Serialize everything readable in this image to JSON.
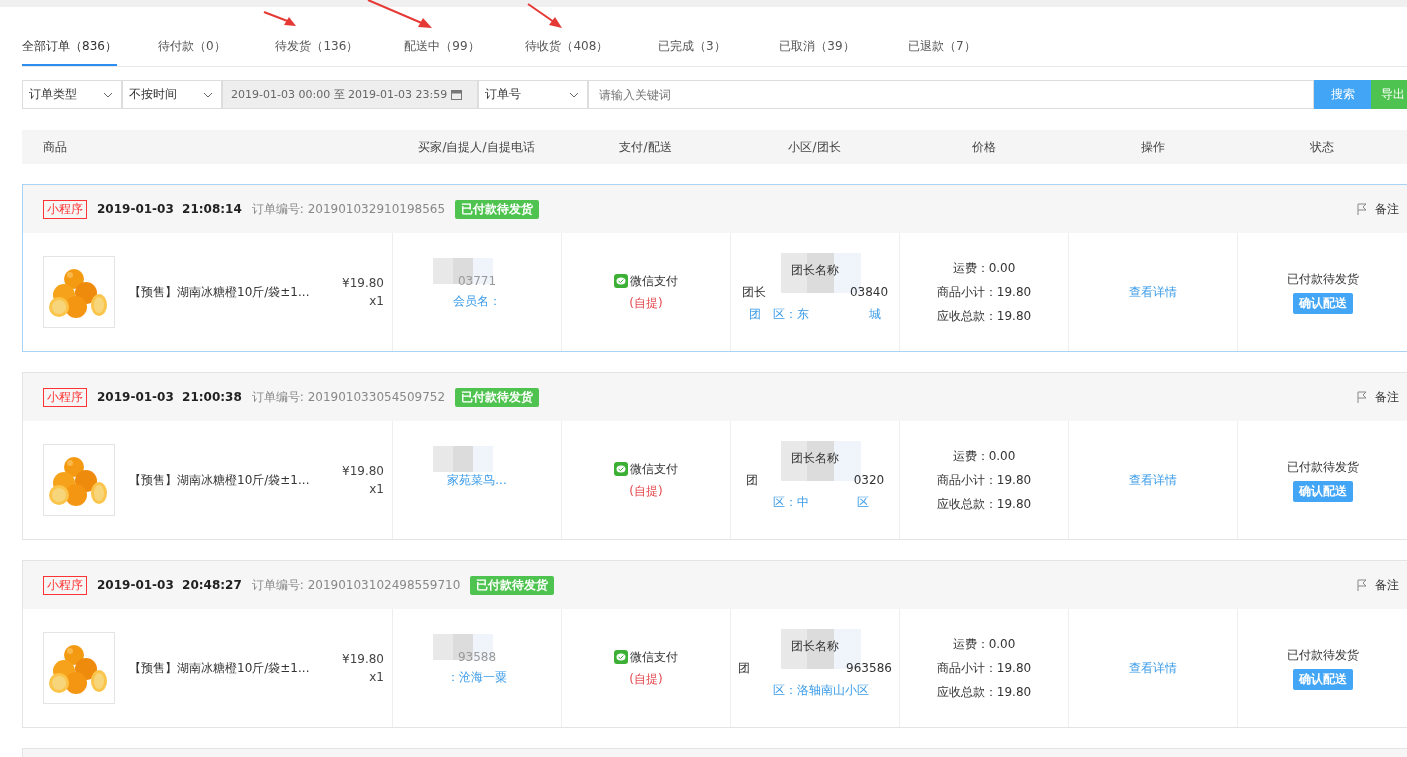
{
  "tabs": [
    {
      "label": "全部订单（836）",
      "selected": true
    },
    {
      "label": "待付款（0）",
      "selected": false
    },
    {
      "label": "待发货（136）",
      "selected": false
    },
    {
      "label": "配送中（99）",
      "selected": false
    },
    {
      "label": "待收货（408）",
      "selected": false
    },
    {
      "label": "已完成（3）",
      "selected": false
    },
    {
      "label": "已取消（39）",
      "selected": false
    },
    {
      "label": "已退款（7）",
      "selected": false
    }
  ],
  "filters": {
    "order_type": "订单类型",
    "time_mode": "不按时间",
    "date_range": "2019-01-03 00:00 至 2019-01-03 23:59",
    "field": "订单号",
    "placeholder": "请输入关键词",
    "search_button": "搜索",
    "export_button": "导出"
  },
  "columns": [
    "商品",
    "买家/自提人/自提电话",
    "支付/配送",
    "小区/团长",
    "价格",
    "操作",
    "状态"
  ],
  "orders": [
    {
      "source": "小程序",
      "datetime": "2019-01-03  21:08:14",
      "order_no": "订单编号: 201901032910198565",
      "badge": "已付款待发货",
      "remark": "备注",
      "product": {
        "name": "【预售】湖南冰糖橙10斤/袋±1...",
        "price": "¥19.80",
        "qty": "x1"
      },
      "buyer": [
        {
          "text": "03771",
          "kind": "plain"
        },
        {
          "text": "会员名：",
          "kind": "link"
        }
      ],
      "payment": "微信支付",
      "delivery": "(自提)",
      "leader": [
        {
          "text": "团长名称",
          "kind": "plain"
        },
        {
          "text": "团长　　　　　　　03840",
          "kind": "plain"
        },
        {
          "text": "团　区：东　　　　　城",
          "kind": "link"
        }
      ],
      "fees": [
        "运费：0.00",
        "商品小计：19.80",
        "应收总款：19.80"
      ],
      "action": "查看详情",
      "status": "已付款待发货",
      "confirm": "确认配送",
      "highlighted": true
    },
    {
      "source": "小程序",
      "datetime": "2019-01-03  21:00:38",
      "order_no": "订单编号: 201901033054509752",
      "badge": "已付款待发货",
      "remark": "备注",
      "product": {
        "name": "【预售】湖南冰糖橙10斤/袋±1...",
        "price": "¥19.80",
        "qty": "x1"
      },
      "buyer": [
        {
          "text": "家苑菜鸟...",
          "kind": "link"
        }
      ],
      "payment": "微信支付",
      "delivery": "(自提)",
      "leader": [
        {
          "text": "团长名称",
          "kind": "plain"
        },
        {
          "text": "团　　　　　　　　0320",
          "kind": "plain"
        },
        {
          "text": "　区：中　　　　区",
          "kind": "link"
        }
      ],
      "fees": [
        "运费：0.00",
        "商品小计：19.80",
        "应收总款：19.80"
      ],
      "action": "查看详情",
      "status": "已付款待发货",
      "confirm": "确认配送",
      "highlighted": false
    },
    {
      "source": "小程序",
      "datetime": "2019-01-03  20:48:27",
      "order_no": "订单编号: 20190103102498559710",
      "badge": "已付款待发货",
      "remark": "备注",
      "product": {
        "name": "【预售】湖南冰糖橙10斤/袋±1...",
        "price": "¥19.80",
        "qty": "x1"
      },
      "buyer": [
        {
          "text": "93588",
          "kind": "plain"
        },
        {
          "text": "：沧海一粟",
          "kind": "link"
        }
      ],
      "payment": "微信支付",
      "delivery": "(自提)",
      "leader": [
        {
          "text": "团长名称",
          "kind": "plain"
        },
        {
          "text": "团　　　　　　　　963586",
          "kind": "plain"
        },
        {
          "text": "　区：洛轴南山小区",
          "kind": "link"
        }
      ],
      "fees": [
        "运费：0.00",
        "商品小计：19.80",
        "应收总款：19.80"
      ],
      "action": "查看详情",
      "status": "已付款待发货",
      "confirm": "确认配送",
      "highlighted": false
    }
  ]
}
